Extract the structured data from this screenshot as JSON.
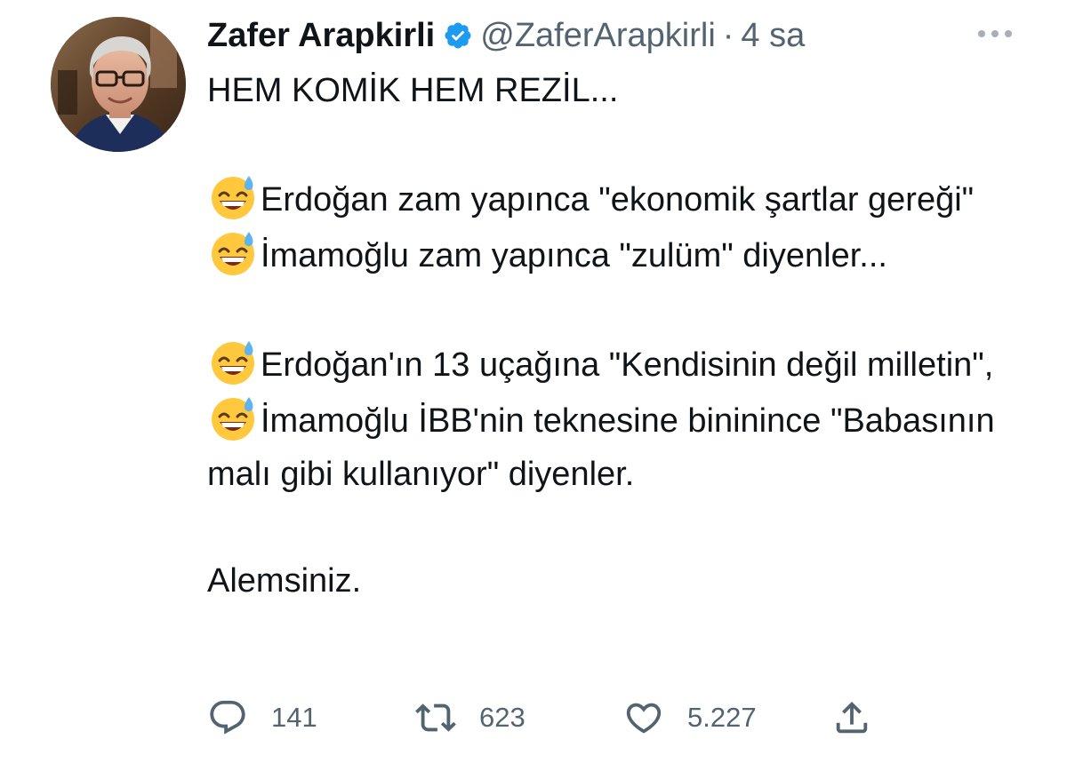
{
  "tweet": {
    "author": {
      "display_name": "Zafer Arapkirli",
      "handle": "@ZaferArapkirli",
      "verified": true,
      "avatar_icon": "avatar-photo"
    },
    "separator": "·",
    "time": "4 sa",
    "more_icon": "more-dots-icon",
    "body": {
      "line1": "HEM KOMİK HEM REZİL...",
      "emoji": "sweat-smile-emoji",
      "para1": "Erdoğan zam yapınca \"ekonomik şartlar gereği\"",
      "para2": "İmamoğlu zam yapınca \"zulüm\" diyenler...",
      "para3": "Erdoğan'ın 13 uçağına \"Kendisinin değil milletin\",",
      "para4": "İmamoğlu İBB'nin teknesine bininince \"Babasının malı gibi kullanıyor\" diyenler.",
      "closing": "Alemsiniz."
    },
    "actions": {
      "replies": "141",
      "retweets": "623",
      "likes": "5.227",
      "share_icon": "share-icon"
    },
    "colors": {
      "text": "#0f1419",
      "secondary": "#536471",
      "verified_badge": "#1d9bf0"
    }
  }
}
